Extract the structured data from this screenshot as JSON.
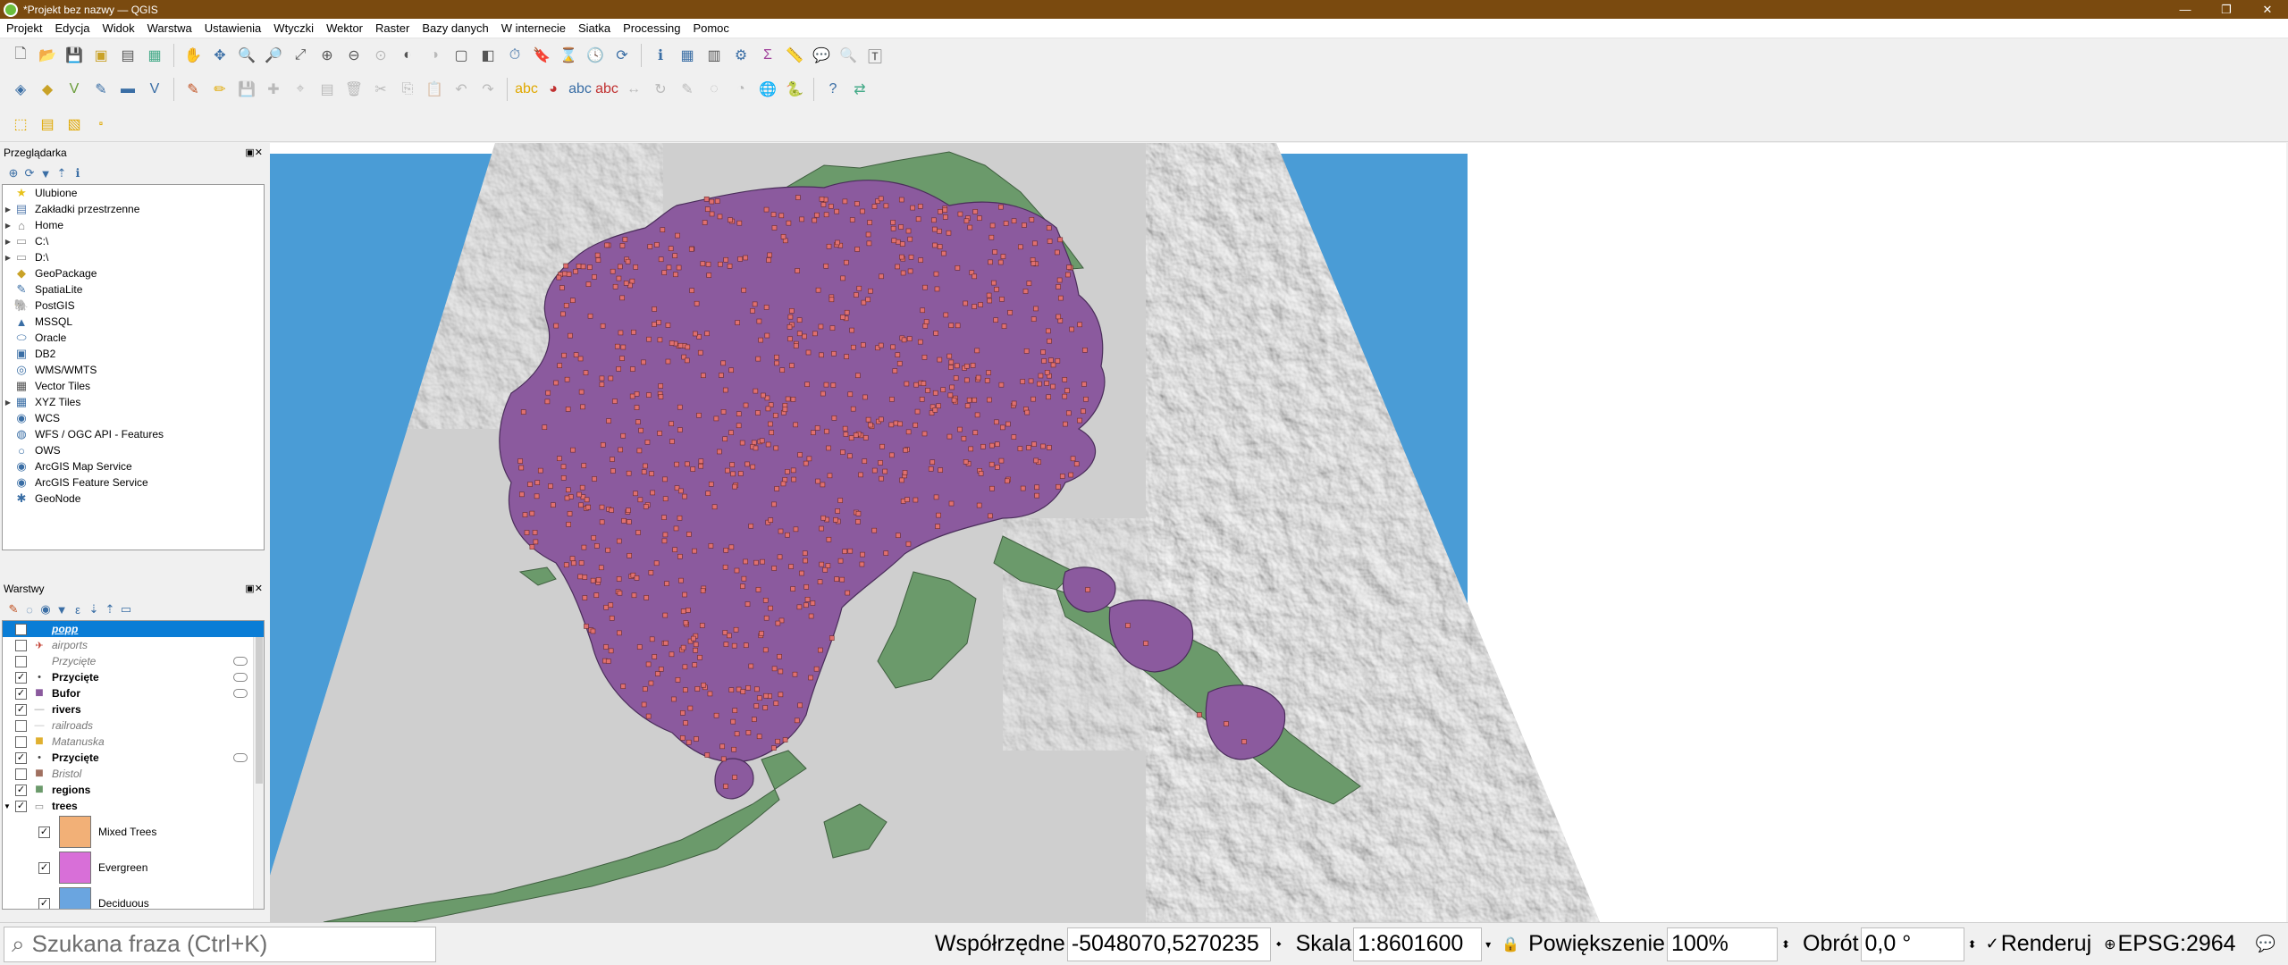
{
  "window": {
    "title": "*Projekt bez nazwy — QGIS",
    "minimize": "—",
    "restore": "❐",
    "close": "✕"
  },
  "menu": [
    "Projekt",
    "Edycja",
    "Widok",
    "Warstwa",
    "Ustawienia",
    "Wtyczki",
    "Wektor",
    "Raster",
    "Bazy danych",
    "W internecie",
    "Siatka",
    "Processing",
    "Pomoc"
  ],
  "browser": {
    "title": "Przeglądarka",
    "items": [
      {
        "label": "Ulubione",
        "icon": "star-icon",
        "glyph": "★",
        "color": "#e8c21a",
        "expand": false
      },
      {
        "label": "Zakładki przestrzenne",
        "icon": "bookmark-icon",
        "glyph": "▤",
        "color": "#5a7fb0",
        "expand": true
      },
      {
        "label": "Home",
        "icon": "home-folder-icon",
        "glyph": "⌂",
        "color": "#777",
        "expand": true
      },
      {
        "label": "C:\\",
        "icon": "folder-icon",
        "glyph": "▭",
        "color": "#999",
        "expand": true
      },
      {
        "label": "D:\\",
        "icon": "folder-icon",
        "glyph": "▭",
        "color": "#999",
        "expand": true
      },
      {
        "label": "GeoPackage",
        "icon": "geopackage-icon",
        "glyph": "◆",
        "color": "#c9a227",
        "expand": false
      },
      {
        "label": "SpatiaLite",
        "icon": "spatialite-icon",
        "glyph": "✎",
        "color": "#3a6ea5",
        "expand": false
      },
      {
        "label": "PostGIS",
        "icon": "postgis-icon",
        "glyph": "🐘",
        "color": "#3a6ea5",
        "expand": false
      },
      {
        "label": "MSSQL",
        "icon": "mssql-icon",
        "glyph": "▲",
        "color": "#3a6ea5",
        "expand": false
      },
      {
        "label": "Oracle",
        "icon": "oracle-icon",
        "glyph": "⬭",
        "color": "#3a6ea5",
        "expand": false
      },
      {
        "label": "DB2",
        "icon": "db2-icon",
        "glyph": "▣",
        "color": "#3a6ea5",
        "expand": false
      },
      {
        "label": "WMS/WMTS",
        "icon": "wms-icon",
        "glyph": "◎",
        "color": "#3a6ea5",
        "expand": false
      },
      {
        "label": "Vector Tiles",
        "icon": "vector-tiles-icon",
        "glyph": "▦",
        "color": "#555",
        "expand": false
      },
      {
        "label": "XYZ Tiles",
        "icon": "xyz-tiles-icon",
        "glyph": "▦",
        "color": "#3a6ea5",
        "expand": true
      },
      {
        "label": "WCS",
        "icon": "wcs-icon",
        "glyph": "◉",
        "color": "#3a6ea5",
        "expand": false
      },
      {
        "label": "WFS / OGC API - Features",
        "icon": "wfs-icon",
        "glyph": "◍",
        "color": "#3a6ea5",
        "expand": false
      },
      {
        "label": "OWS",
        "icon": "ows-icon",
        "glyph": "○",
        "color": "#3a6ea5",
        "expand": false
      },
      {
        "label": "ArcGIS Map Service",
        "icon": "arcgis-map-icon",
        "glyph": "◉",
        "color": "#3a6ea5",
        "expand": false
      },
      {
        "label": "ArcGIS Feature Service",
        "icon": "arcgis-feature-icon",
        "glyph": "◉",
        "color": "#3a6ea5",
        "expand": false
      },
      {
        "label": "GeoNode",
        "icon": "geonode-icon",
        "glyph": "✱",
        "color": "#3a6ea5",
        "expand": false
      }
    ]
  },
  "layers": {
    "title": "Warstwy",
    "items": [
      {
        "label": "popp",
        "checked": false,
        "style": "selected",
        "symbol": "",
        "eye": false
      },
      {
        "label": "airports",
        "checked": false,
        "style": "italic",
        "symbol": "✈",
        "symcolor": "#c0392b",
        "eye": false
      },
      {
        "label": "Przycięte",
        "checked": false,
        "style": "italic",
        "symbol": "",
        "eye": true
      },
      {
        "label": "Przycięte",
        "checked": true,
        "style": "bold",
        "symbol": "•",
        "symcolor": "#444",
        "eye": true
      },
      {
        "label": "Bufor",
        "checked": true,
        "style": "bold",
        "symbol": "■",
        "symcolor": "#8b5a9e",
        "eye": true
      },
      {
        "label": "rivers",
        "checked": true,
        "style": "bold",
        "symbol": "—",
        "symcolor": "#999",
        "eye": false
      },
      {
        "label": "railroads",
        "checked": false,
        "style": "italic",
        "symbol": "—",
        "symcolor": "#bbb",
        "eye": false
      },
      {
        "label": "Matanuska",
        "checked": false,
        "style": "italic",
        "symbol": "■",
        "symcolor": "#e0b030",
        "eye": false
      },
      {
        "label": "Przycięte",
        "checked": true,
        "style": "bold",
        "symbol": "•",
        "symcolor": "#444",
        "eye": true
      },
      {
        "label": "Bristol",
        "checked": false,
        "style": "italic",
        "symbol": "■",
        "symcolor": "#a07060",
        "eye": false
      },
      {
        "label": "regions",
        "checked": true,
        "style": "bold",
        "symbol": "■",
        "symcolor": "#6b9a6b",
        "eye": false
      },
      {
        "label": "trees",
        "checked": true,
        "style": "bold",
        "symbol": "▭",
        "symcolor": "#888",
        "eye": false
      }
    ],
    "legend": [
      {
        "label": "Mixed Trees",
        "color": "#f2b077",
        "checked": true
      },
      {
        "label": "Evergreen",
        "color": "#d86fd8",
        "checked": true
      },
      {
        "label": "Deciduous",
        "color": "#6aa5e0",
        "checked": true
      }
    ]
  },
  "status": {
    "search_placeholder": "Szukana fraza (Ctrl+K)",
    "coord_label": "Współrzędne",
    "coord_value": "-5048070,5270235",
    "scale_label": "Skala",
    "scale_value": "1:8601600",
    "zoom_label": "Powiększenie",
    "zoom_value": "100%",
    "rotation_label": "Obrót",
    "rotation_value": "0,0 °",
    "render_label": "Renderuj",
    "crs": "EPSG:2964"
  },
  "map_colors": {
    "ocean": "#4a9cd6",
    "land": "#cfcfcf",
    "regions": "#6b9a6b",
    "buffer": "#8b5a9e",
    "points": "#e07070"
  }
}
